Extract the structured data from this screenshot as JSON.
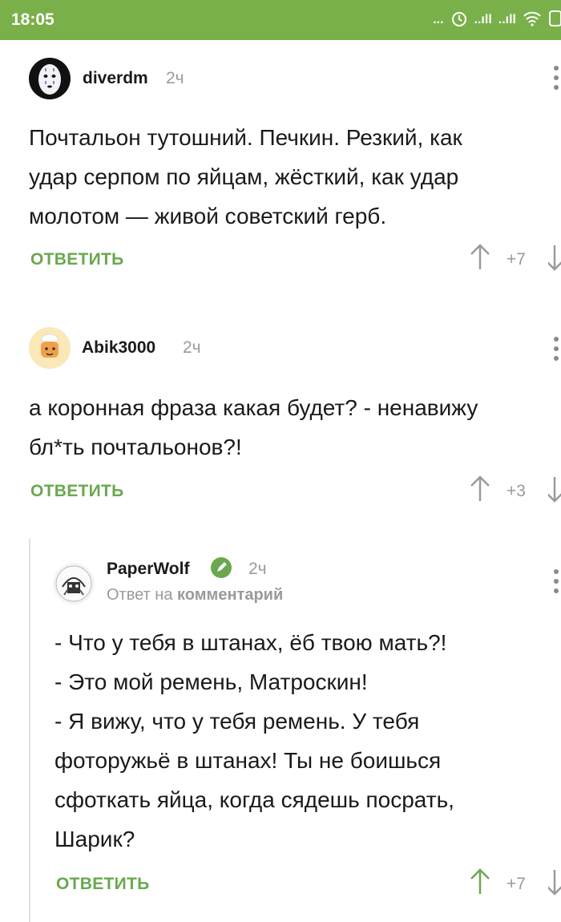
{
  "status_bar": {
    "time": "18:05",
    "dots": "...",
    "signal1": "..ıll",
    "signal2": "..ıll"
  },
  "comments": [
    {
      "username": "diverdm",
      "time": "2ч",
      "text": "Почтальон тутошний. Печкин. Резкий, как\nудар серпом по яйцам, жёсткий, как удар\nмолотом — живой советский герб.",
      "reply_label": "ОТВЕТИТЬ",
      "rating": "+7"
    },
    {
      "username": "Abik3000",
      "time": "2ч",
      "text": "а коронная фраза какая будет? - ненавижу\nбл*ть почтальонов?!",
      "reply_label": "ОТВЕТИТЬ",
      "rating": "+3"
    },
    {
      "username": "PaperWolf",
      "time": "2ч",
      "reply_to_prefix": "Ответ на",
      "reply_to_target": "комментарий",
      "text": "- Что у тебя в штанах, ёб твою мать?!\n- Это мой ремень, Матроскин!\n- Я вижу, что у тебя ремень. У тебя\nфоторужьё в штанах! Ты не боишься\nсфоткать яйца, когда сядешь посрать,\nШарик?",
      "reply_label": "ОТВЕТИТЬ",
      "rating": "+7"
    }
  ],
  "colors": {
    "statusbar": "#7ab04a",
    "accent_green": "#6aa84f",
    "muted": "#9a9a9a"
  }
}
